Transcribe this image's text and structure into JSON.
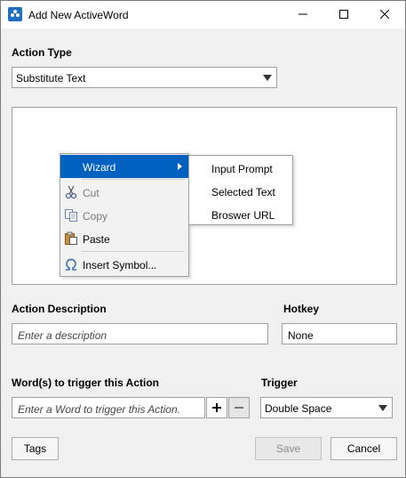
{
  "window": {
    "title": "Add New ActiveWord"
  },
  "action_type": {
    "label": "Action Type",
    "value": "Substitute Text"
  },
  "context_menu": {
    "items": [
      {
        "label": "Wizard",
        "icon": "",
        "state": "highlighted"
      },
      {
        "label": "Cut",
        "icon": "scissors-icon",
        "state": "disabled"
      },
      {
        "label": "Copy",
        "icon": "copy-icon",
        "state": "disabled"
      },
      {
        "label": "Paste",
        "icon": "paste-icon",
        "state": "enabled"
      },
      {
        "label": "Insert Symbol...",
        "icon": "omega-icon",
        "state": "enabled"
      }
    ],
    "submenu": [
      "Input Prompt",
      "Selected Text",
      "Broswer URL"
    ]
  },
  "description": {
    "label": "Action Description",
    "placeholder": "Enter a description"
  },
  "hotkey": {
    "label": "Hotkey",
    "value": "None"
  },
  "words": {
    "label": "Word(s) to trigger this Action",
    "placeholder": "Enter a Word to trigger this Action."
  },
  "trigger": {
    "label": "Trigger",
    "value": "Double Space"
  },
  "buttons": {
    "tags": "Tags",
    "save": "Save",
    "cancel": "Cancel",
    "add": "+",
    "remove": "−"
  },
  "colors": {
    "accent": "#0060c0",
    "app_icon": "#1f6fc5"
  }
}
